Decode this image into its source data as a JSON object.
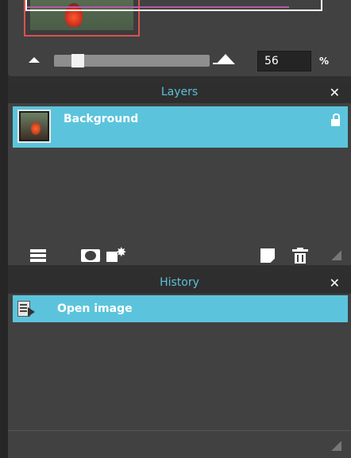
{
  "navigator": {
    "zoom_value": "56",
    "zoom_unit": "%",
    "zoom_slider_fraction": 0.12
  },
  "layers": {
    "title": "Layers",
    "close": "✕",
    "items": [
      {
        "name": "Background",
        "locked": true,
        "selected": true
      }
    ]
  },
  "history": {
    "title": "History",
    "close": "✕",
    "items": [
      {
        "label": "Open image",
        "selected": true
      }
    ]
  },
  "icons": {
    "zoom_out": "mountain-small-icon",
    "zoom_in": "mountain-large-icon",
    "lock": "lock-icon",
    "adjustments": "adjustments-icon",
    "mask": "mask-icon",
    "fx": "layer-style-icon",
    "new_layer": "new-layer-icon",
    "delete": "trash-icon",
    "resize": "resize-corner-icon",
    "open_image": "open-image-icon"
  },
  "colors": {
    "panel_bg": "#414141",
    "header_bg": "#2e2e2e",
    "accent": "#5bc4dc",
    "title_text": "#5cc1d9",
    "nav_frame": "#d9534f"
  }
}
